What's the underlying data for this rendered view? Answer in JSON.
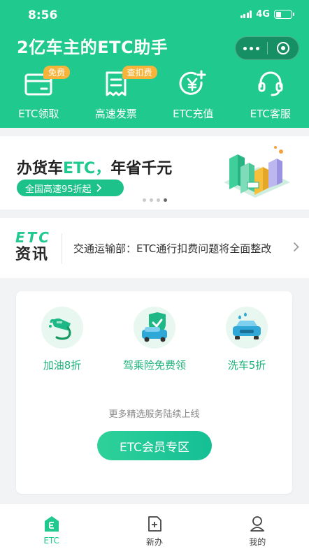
{
  "status_bar": {
    "time": "8:56",
    "network": "4G"
  },
  "header": {
    "title": "2亿车主的ETC助手"
  },
  "quick_actions": [
    {
      "label": "ETC领取",
      "icon": "card-icon",
      "badge": "免费"
    },
    {
      "label": "高速发票",
      "icon": "receipt-icon",
      "badge": "查扣费"
    },
    {
      "label": "ETC充值",
      "icon": "yuan-add-icon"
    },
    {
      "label": "ETC客服",
      "icon": "headset-icon"
    }
  ],
  "banner": {
    "title_prefix": "办货车",
    "title_highlight": "ETC，",
    "title_suffix": "年省千元",
    "button_label": "全国高速95折起",
    "page_count": 4,
    "active_page": 4
  },
  "news": {
    "logo_top": "ETC",
    "logo_bottom": "资讯",
    "headline": "交通运输部：ETC通行扣费问题将全面整改"
  },
  "services": [
    {
      "label": "加油8折",
      "icon": "fuel-nozzle-icon"
    },
    {
      "label": "驾乘险免费领",
      "icon": "car-insurance-shield-icon"
    },
    {
      "label": "洗车5折",
      "icon": "car-wash-icon"
    }
  ],
  "services_footer": {
    "more_text": "更多精选服务陆续上线",
    "member_button": "ETC会员专区"
  },
  "tabbar": [
    {
      "label": "ETC",
      "icon": "etc-home-icon",
      "active": true
    },
    {
      "label": "新办",
      "icon": "new-document-icon",
      "active": false
    },
    {
      "label": "我的",
      "icon": "profile-icon",
      "active": false
    }
  ],
  "colors": {
    "brand": "#20c98e",
    "badge": "#f6b53a",
    "service_text": "#1fb37b"
  }
}
